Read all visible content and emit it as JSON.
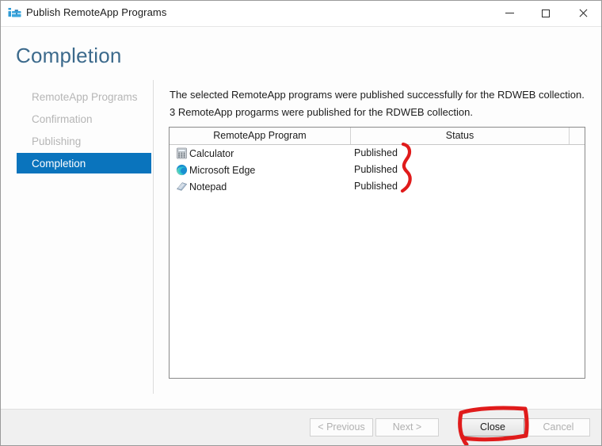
{
  "window": {
    "title": "Publish RemoteApp Programs",
    "icon": "remoteapp-toolbox-icon",
    "controls": {
      "minimize": "minimize-icon",
      "maximize": "maximize-icon",
      "close": "close-icon"
    }
  },
  "page": {
    "title": "Completion"
  },
  "sidebar": {
    "items": [
      {
        "label": "RemoteApp Programs",
        "selected": false
      },
      {
        "label": "Confirmation",
        "selected": false
      },
      {
        "label": "Publishing",
        "selected": false
      },
      {
        "label": "Completion",
        "selected": true
      }
    ]
  },
  "main": {
    "messages": [
      "The selected RemoteApp programs were published successfully for the RDWEB collection.",
      "3 RemoteApp progarms were published for the RDWEB collection."
    ],
    "table": {
      "columns": [
        "RemoteApp Program",
        "Status",
        ""
      ],
      "rows": [
        {
          "name": "Calculator",
          "status": "Published",
          "icon": "calculator-icon"
        },
        {
          "name": "Microsoft Edge",
          "status": "Published",
          "icon": "microsoft-edge-icon"
        },
        {
          "name": "Notepad",
          "status": "Published",
          "icon": "notepad-icon"
        }
      ]
    }
  },
  "footer": {
    "previous_label": "< Previous",
    "next_label": "Next >",
    "close_label": "Close",
    "cancel_label": "Cancel"
  },
  "annotations": {
    "brace": "red-curly-brace-annotation",
    "rect": "red-rectangle-annotation"
  },
  "colors": {
    "accent": "#0a74bd",
    "heading": "#3c6a8c",
    "annotation": "#e01b1b",
    "disabled_text": "#b0b0b0"
  }
}
